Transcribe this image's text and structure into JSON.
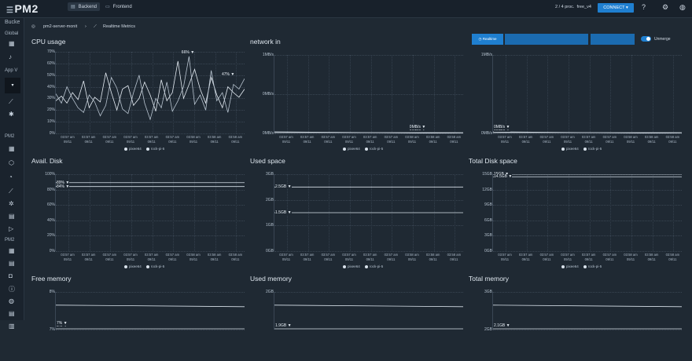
{
  "topbar": {
    "logo": "PM2",
    "tabs": [
      {
        "label": "Backend"
      },
      {
        "label": "Frontend"
      }
    ],
    "procs": "2 / 4 proc.",
    "user": "free_v4",
    "connect_label": "CONNECT"
  },
  "sidebar": {
    "labels": [
      "Bucke",
      "Global",
      "App V",
      "PM2",
      "PM2"
    ]
  },
  "breadcrumb": {
    "server": "pm2-server-monit",
    "page": "Realtime Metrics"
  },
  "controls": {
    "realtime": "Realtime",
    "unmerge": "Unmerge"
  },
  "colors": {
    "accent": "#1f7fd0",
    "bg": "#1f2933",
    "line": "#d8e1ea"
  },
  "chart_data": [
    {
      "type": "line",
      "title": "CPU usage",
      "y_ticks": [
        "70%",
        "60%",
        "50%",
        "40%",
        "30%",
        "20%",
        "10%",
        "0%"
      ],
      "ylim": [
        0,
        70
      ],
      "x_ticks": [
        "03:57 am 09/11",
        "03:57 am 09/11",
        "03:57 am 09/11",
        "03:57 am 09/11",
        "03:57 am 09/11",
        "03:57 am 09/11",
        "03:58 am 09/11",
        "03:58 am 09/11",
        "03:58 am 09/11"
      ],
      "markers": [
        {
          "label": "66%",
          "value": 66
        },
        {
          "label": "47%",
          "value": 47
        }
      ],
      "series": [
        {
          "name": "pixee64",
          "values": [
            28,
            32,
            26,
            35,
            29,
            45,
            22,
            31,
            27,
            52,
            35,
            20,
            38,
            41,
            24,
            30,
            44,
            33,
            19,
            46,
            28,
            35,
            62,
            30,
            42,
            55,
            38,
            26,
            48,
            33,
            22,
            40,
            35,
            31,
            38
          ]
        },
        {
          "name": "rock-pi-5",
          "values": [
            34,
            26,
            40,
            30,
            22,
            18,
            33,
            27,
            15,
            24,
            48,
            39,
            21,
            17,
            35,
            50,
            26,
            12,
            30,
            22,
            44,
            19,
            28,
            40,
            66,
            25,
            33,
            20,
            54,
            28,
            35,
            18,
            42,
            38,
            47
          ]
        }
      ],
      "legend": [
        "pixee64",
        "rock-pi-5"
      ]
    },
    {
      "type": "line",
      "title": "network in",
      "y_ticks": [
        "1MB/s",
        "0MB/s",
        "0MB/s"
      ],
      "markers": [
        {
          "label": "0MB/s"
        },
        {
          "label": "0MB/s"
        }
      ],
      "x_ticks": [
        "03:57 am 09/11",
        "03:57 am 09/11",
        "03:57 am 09/11",
        "03:57 am 09/11",
        "03:57 am 09/11",
        "03:57 am 09/11",
        "03:58 am 09/11",
        "03:58 am 09/11",
        "03:58 am 09/11"
      ],
      "legend": [
        "pixee64",
        "rock-pi-5"
      ]
    },
    {
      "type": "line",
      "title": "",
      "y_ticks": [
        "1MB/s",
        "0MB/s"
      ],
      "markers": [
        {
          "label": "0MB/s"
        },
        {
          "label": "0MB/s"
        }
      ],
      "x_ticks": [
        "03:57 am 09/11",
        "03:57 am 09/11",
        "03:57 am 09/11",
        "03:57 am 09/11",
        "03:57 am 09/11",
        "03:57 am 09/11",
        "03:58 am 09/11",
        "03:58 am 09/11",
        "03:58 am 09/11"
      ],
      "legend": [
        "pixee64",
        "rock-pi-5"
      ]
    },
    {
      "type": "line",
      "title": "Avail. Disk",
      "y_ticks": [
        "100%",
        "80%",
        "60%",
        "40%",
        "20%",
        "0%"
      ],
      "ylim": [
        0,
        100
      ],
      "markers": [
        {
          "label": "89%",
          "value": 89
        },
        {
          "label": "84%",
          "value": 84
        }
      ],
      "x_ticks": [
        "03:57 am 09/11",
        "03:57 am 09/11",
        "03:57 am 09/11",
        "03:57 am 09/11",
        "03:57 am 09/11",
        "03:57 am 09/11",
        "03:58 am 09/11",
        "03:58 am 09/11",
        "03:58 am 09/11"
      ],
      "legend": [
        "pixee64",
        "rock-pi-5"
      ]
    },
    {
      "type": "line",
      "title": "Used space",
      "y_ticks": [
        "3GB",
        "2GB",
        "1GB",
        "0GB"
      ],
      "ylim": [
        0,
        3
      ],
      "markers": [
        {
          "label": "2.5GB",
          "value": 2.5
        },
        {
          "label": "1.5GB",
          "value": 1.5
        }
      ],
      "x_ticks": [
        "03:57 am 09/11",
        "03:57 am 09/11",
        "03:57 am 09/11",
        "03:57 am 09/11",
        "03:57 am 09/11",
        "03:57 am 09/11",
        "03:58 am 09/11",
        "03:58 am 09/11",
        "03:58 am 09/11"
      ],
      "legend": [
        "pixee64",
        "rock-pi-5"
      ]
    },
    {
      "type": "line",
      "title": "Total Disk space",
      "y_ticks": [
        "15GB",
        "12GB",
        "9GB",
        "6GB",
        "3GB",
        "0GB"
      ],
      "ylim": [
        0,
        15
      ],
      "markers": [
        {
          "label": "15GB",
          "value": 15
        },
        {
          "label": "14.5GB",
          "value": 14.5
        }
      ],
      "x_ticks": [
        "03:57 am 09/11",
        "03:57 am 09/11",
        "03:57 am 09/11",
        "03:57 am 09/11",
        "03:57 am 09/11",
        "03:57 am 09/11",
        "03:58 am 09/11",
        "03:58 am 09/11",
        "03:58 am 09/11"
      ],
      "legend": [
        "pixee64",
        "rock-pi-5"
      ]
    },
    {
      "type": "line",
      "title": "Free memory",
      "y_ticks": [
        "8%",
        "7%"
      ],
      "markers": [
        {
          "label": "8%"
        },
        {
          "label": "7%"
        }
      ]
    },
    {
      "type": "line",
      "title": "Used memory",
      "y_ticks": [
        "2GB"
      ],
      "markers": [
        {
          "label": "1.9GB"
        }
      ]
    },
    {
      "type": "line",
      "title": "Total memory",
      "y_ticks": [
        "3GB",
        "2GB"
      ],
      "markers": [
        {
          "label": "2.1GB"
        }
      ]
    }
  ]
}
